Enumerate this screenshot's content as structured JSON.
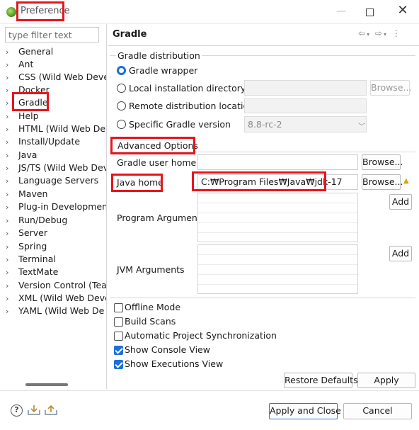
{
  "window": {
    "title": "Preference",
    "close_glyph": "✕"
  },
  "filter": {
    "placeholder": "type filter text"
  },
  "tree": [
    {
      "label": "General"
    },
    {
      "label": "Ant"
    },
    {
      "label": "CSS (Wild Web Deve"
    },
    {
      "label": "Docker"
    },
    {
      "label": "Gradle"
    },
    {
      "label": "Help"
    },
    {
      "label": "HTML (Wild Web De"
    },
    {
      "label": "Install/Update"
    },
    {
      "label": "Java"
    },
    {
      "label": "JS/TS (Wild Web Dev"
    },
    {
      "label": "Language Servers"
    },
    {
      "label": "Maven"
    },
    {
      "label": "Plug-in Developmen"
    },
    {
      "label": "Run/Debug"
    },
    {
      "label": "Server"
    },
    {
      "label": "Spring"
    },
    {
      "label": "Terminal"
    },
    {
      "label": "TextMate"
    },
    {
      "label": "Version Control (Tea"
    },
    {
      "label": "XML (Wild Web Deve"
    },
    {
      "label": "YAML (Wild Web De"
    }
  ],
  "page": {
    "title": "Gradle",
    "distribution": {
      "legend": "Gradle distribution",
      "wrapper": "Gradle wrapper",
      "local_dir": "Local installation directory",
      "browse": "Browse...",
      "remote": "Remote distribution location",
      "specific": "Specific Gradle version",
      "version": "8.8-rc-2"
    },
    "advanced": {
      "legend": "Advanced Options",
      "user_home_label": "Gradle user home",
      "user_home_value": "",
      "browse1": "Browse...",
      "java_home_label": "Java home",
      "java_home_value": "C:₩Program Files₩Java₩jdk-17",
      "browse2": "Browse...",
      "warning_icon": "warning-icon",
      "program_args_label": "Program Arguments",
      "add1": "Add",
      "jvm_args_label": "JVM Arguments",
      "add2": "Add"
    },
    "options": [
      {
        "label": "Offline Mode",
        "checked": false
      },
      {
        "label": "Build Scans",
        "checked": false
      },
      {
        "label": "Automatic Project Synchronization",
        "checked": false
      },
      {
        "label": "Show Console View",
        "checked": true
      },
      {
        "label": "Show Executions View",
        "checked": true
      }
    ],
    "restore_defaults": "Restore Defaults",
    "apply": "Apply"
  },
  "footer": {
    "help_glyph": "?",
    "apply_close": "Apply and Close",
    "cancel": "Cancel"
  },
  "colors": {
    "accent": "#1e6fd9",
    "highlight": "#e8141c"
  }
}
